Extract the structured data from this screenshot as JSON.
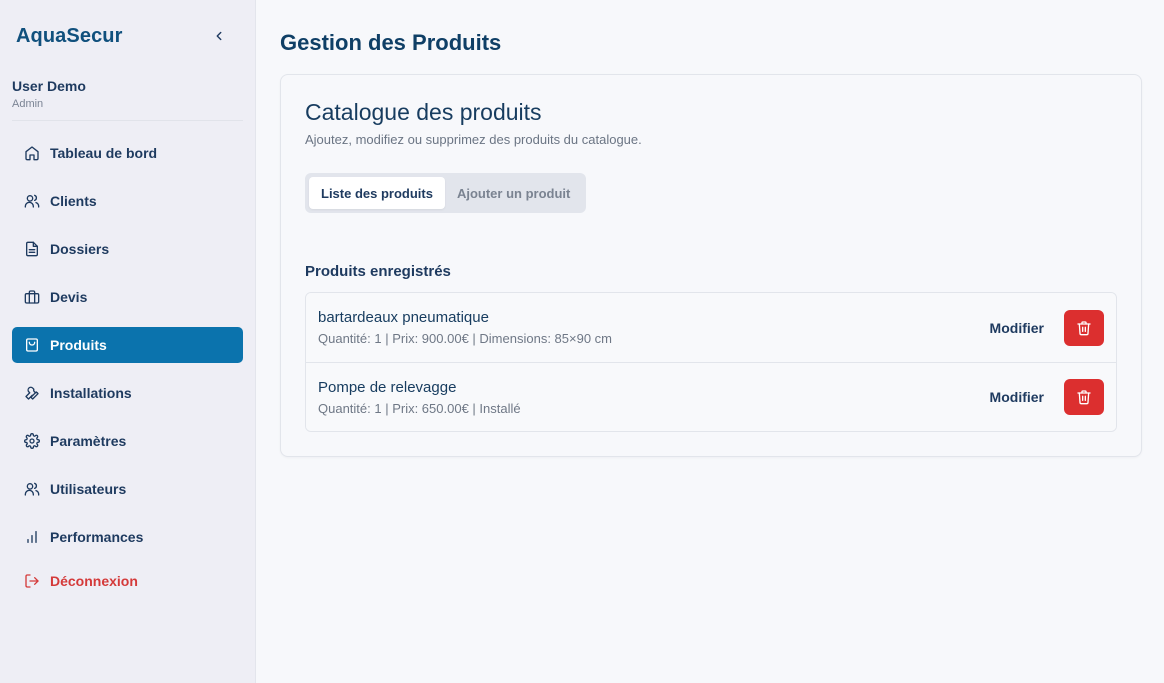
{
  "app": {
    "brand": "AquaSecur",
    "collapse_icon": "chevron-left-icon"
  },
  "user": {
    "name": "User Demo",
    "role": "Admin"
  },
  "sidebar": {
    "items": [
      {
        "label": "Tableau de bord",
        "icon": "home-icon",
        "active": false
      },
      {
        "label": "Clients",
        "icon": "users-icon",
        "active": false
      },
      {
        "label": "Dossiers",
        "icon": "file-icon",
        "active": false
      },
      {
        "label": "Devis",
        "icon": "briefcase-icon",
        "active": false
      },
      {
        "label": "Produits",
        "icon": "shopping-bag-icon",
        "active": true
      },
      {
        "label": "Installations",
        "icon": "wrench-icon",
        "active": false
      },
      {
        "label": "Paramètres",
        "icon": "gear-icon",
        "active": false
      },
      {
        "label": "Utilisateurs",
        "icon": "users-icon",
        "active": false
      },
      {
        "label": "Performances",
        "icon": "bar-chart-icon",
        "active": false
      }
    ],
    "logout": {
      "label": "Déconnexion",
      "icon": "logout-icon"
    }
  },
  "page": {
    "title": "Gestion des Produits"
  },
  "catalog": {
    "title": "Catalogue des produits",
    "subtitle": "Ajoutez, modifiez ou supprimez des produits du catalogue.",
    "tabs": [
      {
        "label": "Liste des produits",
        "active": true
      },
      {
        "label": "Ajouter un produit",
        "active": false
      }
    ],
    "section_title": "Produits enregistrés",
    "products": [
      {
        "name": "bartardeaux pneumatique",
        "meta": "Quantité: 1 | Prix: 900.00€ | Dimensions: 85×90 cm"
      },
      {
        "name": "Pompe de relevagge",
        "meta": "Quantité: 1 | Prix: 650.00€ | Installé"
      }
    ],
    "edit_label": "Modifier",
    "delete_icon": "trash-icon"
  },
  "colors": {
    "accent": "#0b73ad",
    "brand": "#10507d",
    "danger": "#dc2f2f",
    "logout": "#d43a3a"
  }
}
